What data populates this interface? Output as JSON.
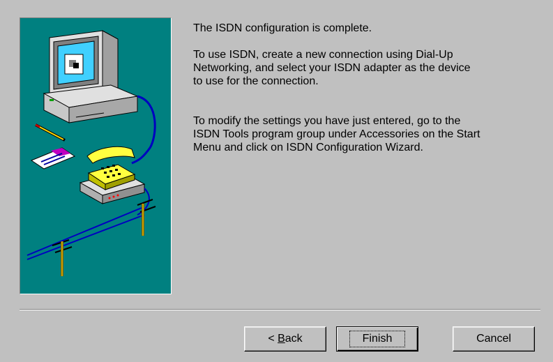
{
  "wizard": {
    "paragraphs": [
      "The ISDN configuration is complete.",
      "To use ISDN, create a new connection using Dial-Up\nNetworking, and select your ISDN adapter as the device\nto use for the connection.",
      "To modify the settings you have just entered, go to the\nISDN Tools program group under Accessories on the Start\nMenu and click on ISDN Configuration Wizard."
    ]
  },
  "buttons": {
    "back_prefix": "< ",
    "back_mnemonic": "B",
    "back_rest": "ack",
    "finish": "Finish",
    "cancel": "Cancel"
  },
  "colors": {
    "dialog_bg": "#c0c0c0",
    "illustration_bg": "#008080"
  },
  "icons": {
    "illustration": "computer-phone-isdn-illustration"
  }
}
